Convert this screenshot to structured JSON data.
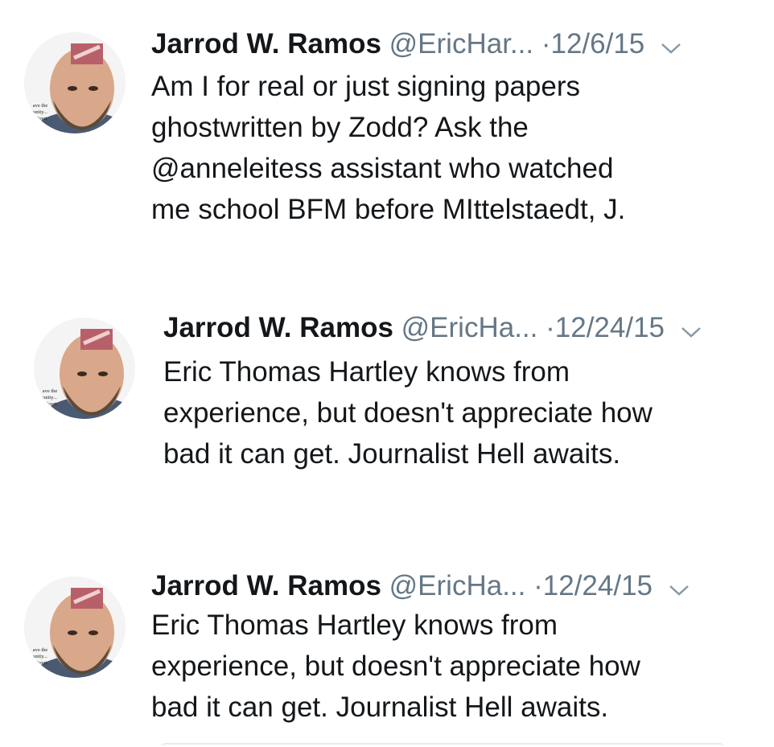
{
  "tweets": [
    {
      "author_name": "Jarrod W. Ramos",
      "handle": "@EricHar...",
      "separator": "·",
      "date": "12/6/15",
      "avatar_caption": [
        "ave the",
        "unity...",
        "' Court"
      ],
      "lines": [
        "Am I for real or just signing papers",
        "ghostwritten by Zodd? Ask the",
        "@anneleitess assistant who watched",
        "me school BFM before MIttelstaedt, J."
      ]
    },
    {
      "author_name": "Jarrod W. Ramos",
      "handle": "@EricHa...",
      "separator": "·",
      "date": "12/24/15",
      "avatar_caption": [
        "ave the",
        "unity...",
        "' Court"
      ],
      "lines": [
        "Eric Thomas Hartley knows from",
        "experience, but doesn't appreciate how",
        "bad it can get. Journalist Hell awaits."
      ]
    },
    {
      "author_name": "Jarrod W. Ramos",
      "handle": "@EricHa...",
      "separator": "·",
      "date": "12/24/15",
      "avatar_caption": [
        "ave the",
        "unity...",
        "' Court"
      ],
      "lines": [
        "Eric Thomas Hartley knows from",
        "experience, but doesn't appreciate how",
        "bad it can get. Journalist Hell awaits."
      ]
    }
  ],
  "icons": {
    "avatar": "profile-photo",
    "caret": "chevron-down-icon"
  },
  "colors": {
    "text": "#14171a",
    "secondary": "#657786",
    "divider": "#e6ecf0"
  }
}
